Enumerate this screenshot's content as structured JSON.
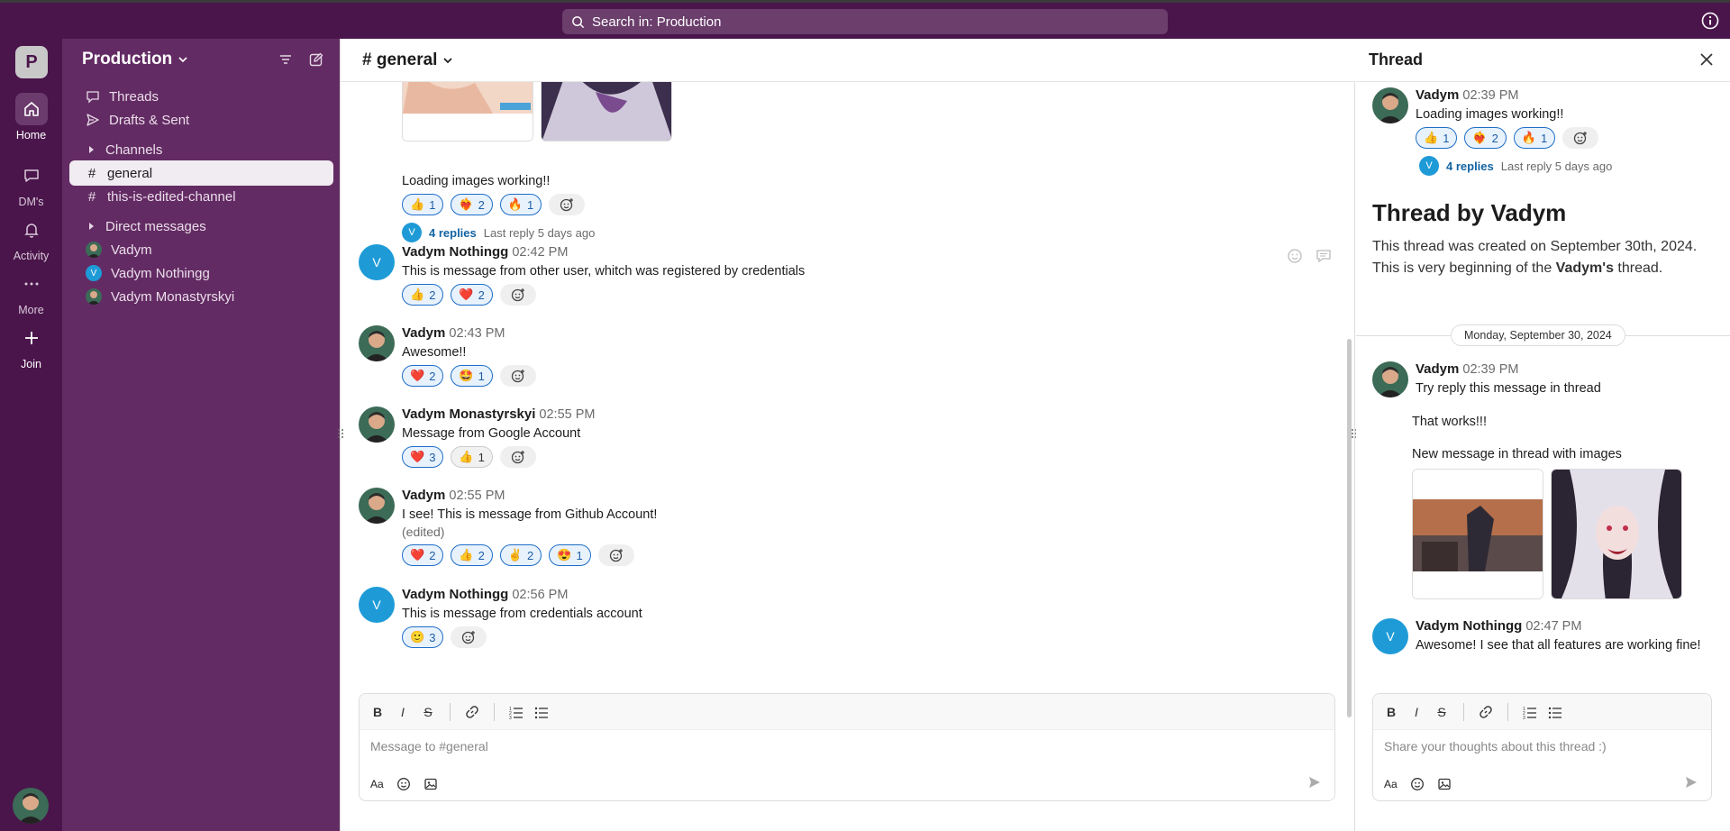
{
  "search": {
    "label": "Search in: Production"
  },
  "rail": {
    "workspace_initial": "P",
    "items": [
      {
        "label": "Home"
      },
      {
        "label": "DM's"
      },
      {
        "label": "Activity"
      },
      {
        "label": "More"
      },
      {
        "label": "Join"
      }
    ]
  },
  "sidebar": {
    "workspace": "Production",
    "threads": "Threads",
    "drafts": "Drafts & Sent",
    "channels_header": "Channels",
    "channels": [
      {
        "name": "general"
      },
      {
        "name": "this-is-edited-channel"
      }
    ],
    "dm_header": "Direct messages",
    "dms": [
      {
        "name": "Vadym"
      },
      {
        "name": "Vadym Nothingg",
        "initial": "V"
      },
      {
        "name": "Vadym Monastyrskyi"
      }
    ]
  },
  "channel": {
    "title": "# general",
    "messages": [
      {
        "text": "Loading images working!!",
        "reactions": [
          {
            "emoji": "👍",
            "count": "1"
          },
          {
            "emoji": "❤️‍🔥",
            "count": "2"
          },
          {
            "emoji": "🔥",
            "count": "1"
          }
        ],
        "replies_initial": "V",
        "replies": "4 replies",
        "last_reply": "Last reply 5 days ago"
      },
      {
        "author": "Vadym Nothingg",
        "initial": "V",
        "time": "02:42 PM",
        "text": "This is message from other user, whitch was registered by credentials",
        "reactions": [
          {
            "emoji": "👍",
            "count": "2"
          },
          {
            "emoji": "❤️",
            "count": "2"
          }
        ]
      },
      {
        "author": "Vadym",
        "time": "02:43 PM",
        "text": "Awesome!!",
        "reactions": [
          {
            "emoji": "❤️",
            "count": "2"
          },
          {
            "emoji": "🤩",
            "count": "1"
          }
        ]
      },
      {
        "author": "Vadym Monastyrskyi",
        "time": "02:55 PM",
        "text": "Message from Google Account",
        "reactions": [
          {
            "emoji": "❤️",
            "count": "3"
          },
          {
            "emoji": "👍",
            "count": "1"
          }
        ]
      },
      {
        "author": "Vadym",
        "time": "02:55 PM",
        "text": "I see! This is message from Github Account!",
        "edited": "(edited)",
        "reactions": [
          {
            "emoji": "❤️",
            "count": "2"
          },
          {
            "emoji": "👍",
            "count": "2"
          },
          {
            "emoji": "✌️",
            "count": "2"
          },
          {
            "emoji": "😍",
            "count": "1"
          }
        ]
      },
      {
        "author": "Vadym Nothingg",
        "initial": "V",
        "time": "02:56 PM",
        "text": "This is message from credentials account",
        "reactions": [
          {
            "emoji": "🙂",
            "count": "3"
          }
        ]
      }
    ],
    "composer_placeholder": "Message to #general"
  },
  "thread": {
    "title": "Thread",
    "root": {
      "author": "Vadym",
      "time": "02:39 PM",
      "text": "Loading images working!!",
      "reactions": [
        {
          "emoji": "👍",
          "count": "1"
        },
        {
          "emoji": "❤️‍🔥",
          "count": "2"
        },
        {
          "emoji": "🔥",
          "count": "1"
        }
      ],
      "replies_initial": "V",
      "replies": "4 replies",
      "last_reply": "Last reply 5 days ago"
    },
    "heading": "Thread by Vadym",
    "desc_prefix": "This thread was created on September 30th, 2024. This is very beginning of the ",
    "desc_bold": "Vadym's",
    "desc_suffix": " thread.",
    "date": "Monday, September 30, 2024",
    "reply1": {
      "author": "Vadym",
      "time": "02:39 PM",
      "line1": "Try reply this message in thread",
      "line2": "That works!!!",
      "line3": "New message in thread with images"
    },
    "reply2": {
      "author": "Vadym Nothingg",
      "initial": "V",
      "time": "02:47 PM",
      "text": "Awesome! I see that all features are working fine!"
    },
    "composer_placeholder": "Share your thoughts about this thread :)"
  },
  "colors": {
    "aubergine": "#4a154b",
    "sidebar": "#632b63",
    "link": "#1264a3",
    "accent_avatar": "#1e9bd7"
  }
}
